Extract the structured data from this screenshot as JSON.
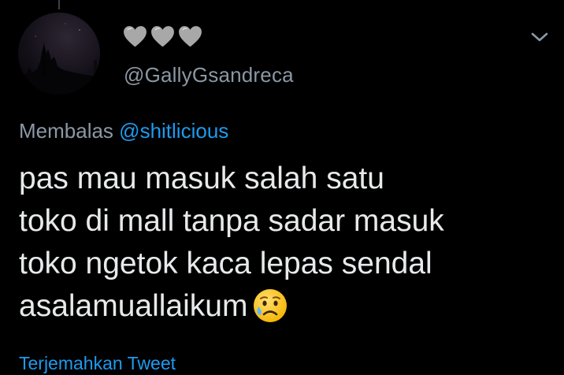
{
  "user": {
    "display_name_icons": [
      "grey-heart-icon",
      "grey-heart-icon",
      "grey-heart-icon"
    ],
    "handle": "@GallyGsandreca"
  },
  "reply": {
    "prefix": "Membalas",
    "mention": "@shitlicious"
  },
  "tweet": {
    "lines": [
      "pas mau masuk salah satu",
      "toko di mall tanpa sadar masuk",
      "toko ngetok kaca lepas sendal",
      "asalamuallaikum"
    ],
    "emoji": "sad-but-relieved-face-icon"
  },
  "actions": {
    "translate_label": "Terjemahkan Tweet"
  },
  "colors": {
    "background": "#000000",
    "text_primary": "#e7e9ea",
    "text_secondary": "#8b98a5",
    "accent": "#1d9bf0",
    "heart": "#a8a8a8"
  }
}
